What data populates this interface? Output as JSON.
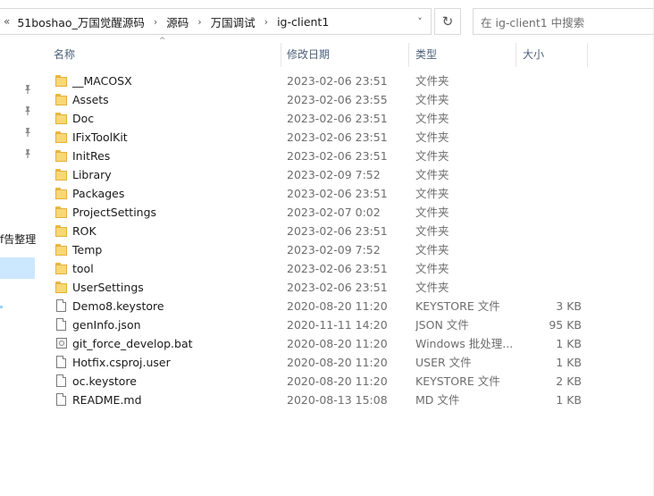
{
  "address_bar": {
    "overflow_chevron": "«",
    "breadcrumbs": [
      "51boshao_万国觉醒源码",
      "源码",
      "万国调试",
      "ig-client1"
    ],
    "separator": "›",
    "dropdown": "˅"
  },
  "refresh_glyph": "↻",
  "search": {
    "placeholder": "在 ig-client1 中搜索"
  },
  "nav": {
    "pin_glyph": "📌",
    "partial_label": "f告整理"
  },
  "columns": {
    "sort_arrow": "^",
    "name": "名称",
    "date": "修改日期",
    "type": "类型",
    "size": "大小"
  },
  "files": [
    {
      "name": "__MACOSX",
      "date": "2023-02-06 23:51",
      "type": "文件夹",
      "size": "",
      "icon": "folder-icon"
    },
    {
      "name": "Assets",
      "date": "2023-02-06 23:55",
      "type": "文件夹",
      "size": "",
      "icon": "folder-icon"
    },
    {
      "name": "Doc",
      "date": "2023-02-06 23:51",
      "type": "文件夹",
      "size": "",
      "icon": "folder-icon"
    },
    {
      "name": "IFixToolKit",
      "date": "2023-02-06 23:51",
      "type": "文件夹",
      "size": "",
      "icon": "folder-icon"
    },
    {
      "name": "InitRes",
      "date": "2023-02-06 23:51",
      "type": "文件夹",
      "size": "",
      "icon": "folder-icon"
    },
    {
      "name": "Library",
      "date": "2023-02-09 7:52",
      "type": "文件夹",
      "size": "",
      "icon": "folder-icon"
    },
    {
      "name": "Packages",
      "date": "2023-02-06 23:51",
      "type": "文件夹",
      "size": "",
      "icon": "folder-icon"
    },
    {
      "name": "ProjectSettings",
      "date": "2023-02-07 0:02",
      "type": "文件夹",
      "size": "",
      "icon": "folder-icon"
    },
    {
      "name": "ROK",
      "date": "2023-02-06 23:51",
      "type": "文件夹",
      "size": "",
      "icon": "folder-icon"
    },
    {
      "name": "Temp",
      "date": "2023-02-09 7:52",
      "type": "文件夹",
      "size": "",
      "icon": "folder-icon"
    },
    {
      "name": "tool",
      "date": "2023-02-06 23:51",
      "type": "文件夹",
      "size": "",
      "icon": "folder-icon"
    },
    {
      "name": "UserSettings",
      "date": "2023-02-06 23:51",
      "type": "文件夹",
      "size": "",
      "icon": "folder-icon"
    },
    {
      "name": "Demo8.keystore",
      "date": "2020-08-20 11:20",
      "type": "KEYSTORE 文件",
      "size": "3 KB",
      "icon": "file-icon"
    },
    {
      "name": "genInfo.json",
      "date": "2020-11-11 14:20",
      "type": "JSON 文件",
      "size": "95 KB",
      "icon": "file-icon"
    },
    {
      "name": "git_force_develop.bat",
      "date": "2020-08-20 11:20",
      "type": "Windows 批处理...",
      "size": "1 KB",
      "icon": "batch-file-icon"
    },
    {
      "name": "Hotfix.csproj.user",
      "date": "2020-08-20 11:20",
      "type": "USER 文件",
      "size": "1 KB",
      "icon": "file-icon"
    },
    {
      "name": "oc.keystore",
      "date": "2020-08-20 11:20",
      "type": "KEYSTORE 文件",
      "size": "2 KB",
      "icon": "file-icon"
    },
    {
      "name": "README.md",
      "date": "2020-08-13 15:08",
      "type": "MD 文件",
      "size": "1 KB",
      "icon": "file-icon"
    }
  ],
  "colors": {
    "folder": "#f8d775",
    "selection": "#cce8ff",
    "header_text": "#4c607a"
  }
}
